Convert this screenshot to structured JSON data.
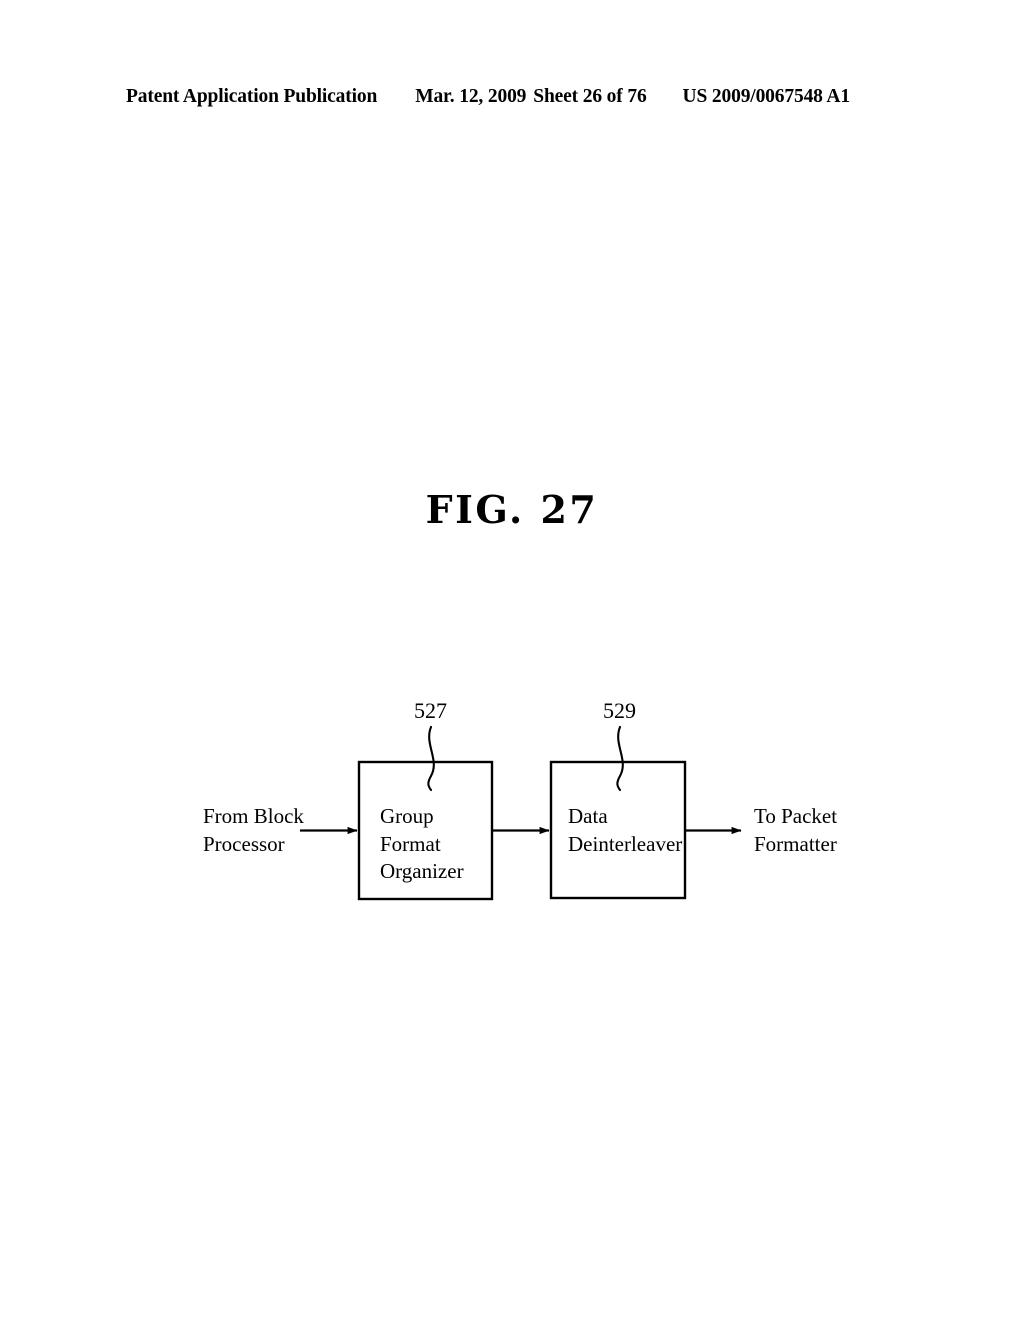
{
  "document": {
    "header": {
      "publication": "Patent Application Publication",
      "date": "Mar. 12, 2009",
      "sheet": "Sheet 26 of 76",
      "patent_number": "US 2009/0067548 A1"
    },
    "figure_title": "FIG. 27",
    "background_color": "#ffffff",
    "ink_color": "#000000"
  },
  "diagram": {
    "type": "block-diagram",
    "input_label": "From Block\nProcessor",
    "output_label": "To Packet\nFormatter",
    "blocks": [
      {
        "id": "group-format-organizer",
        "ref": "527",
        "label": "Group\nFormat\nOrganizer"
      },
      {
        "id": "data-deinterleaver",
        "ref": "529",
        "label": "Data\nDeinterleaver"
      }
    ],
    "connections": [
      {
        "from": "input",
        "to": "group-format-organizer",
        "style": "arrow"
      },
      {
        "from": "group-format-organizer",
        "to": "data-deinterleaver",
        "style": "arrow"
      },
      {
        "from": "data-deinterleaver",
        "to": "output",
        "style": "arrow"
      }
    ]
  }
}
